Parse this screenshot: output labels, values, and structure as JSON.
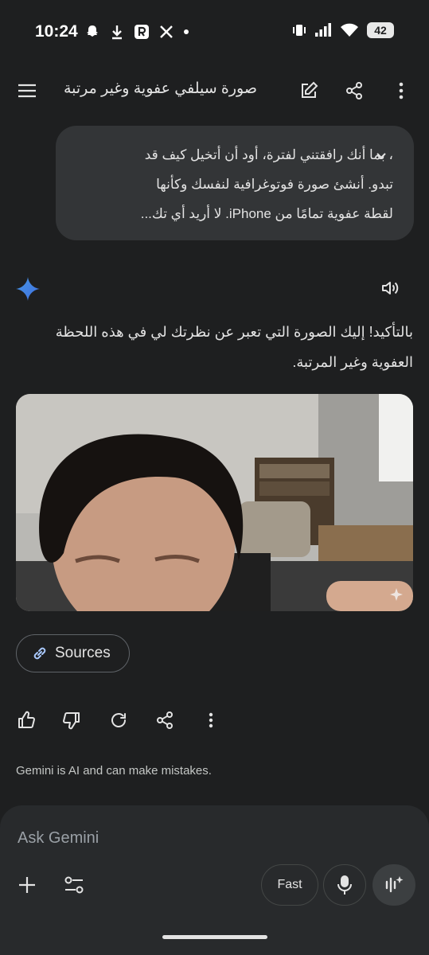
{
  "status": {
    "time": "10:24",
    "battery": "42",
    "icons_left": [
      "snapchat-icon",
      "download-icon",
      "r-app-icon",
      "x-icon",
      "dot-icon"
    ],
    "icons_right": [
      "vibrate-icon",
      "signal-icon",
      "wifi-icon",
      "battery-icon"
    ]
  },
  "header": {
    "title": "صورة سيلفي عفوية وغير مرتبة",
    "icons": [
      "menu-icon",
      "edit-icon",
      "share-icon",
      "more-icon"
    ]
  },
  "user_message": {
    "text": "، بما أنك رافقتني لفترة، أود أن أتخيل كيف قد\nتبدو. أنشئ صورة فوتوغرافية لنفسك وكأنها\nلقطة عفوية تمامًا من iPhone. لا أريد أي تك..."
  },
  "response": {
    "text": "بالتأكيد! إليك الصورة التي تعبر عن نظرتك لي في هذه اللحظة العفوية وغير المرتبة.",
    "sources_label": "Sources",
    "actions": [
      "thumbs-up-icon",
      "thumbs-down-icon",
      "regenerate-icon",
      "share-icon",
      "more-icon"
    ]
  },
  "disclaimer": "Gemini is AI and can make mistakes.",
  "composer": {
    "placeholder": "Ask Gemini",
    "mode_label": "Fast"
  },
  "colors": {
    "background": "#1e1f20",
    "bubble": "#333537",
    "composer": "#282a2c",
    "accent": "#4285f4"
  }
}
